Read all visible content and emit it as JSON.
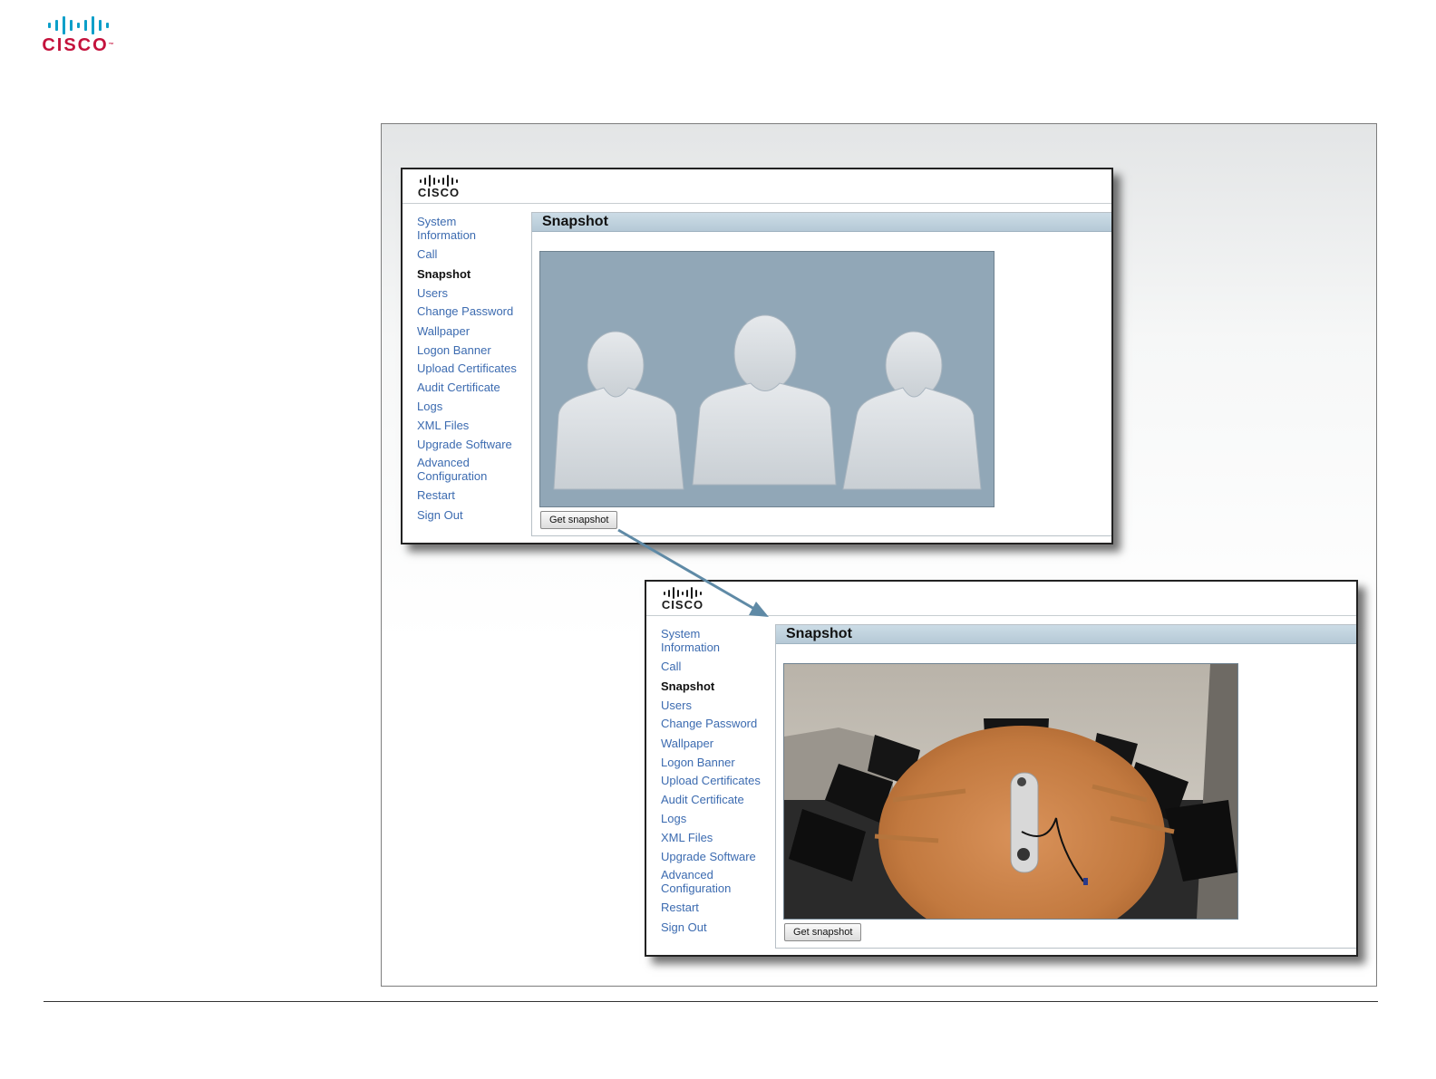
{
  "page": {
    "logo_text": "CISCO",
    "logo_tm": "™"
  },
  "screens": [
    {
      "logo_text": "CISCO",
      "nav": [
        {
          "label": "System Information"
        },
        {
          "label": "Call"
        },
        {
          "label": "Snapshot",
          "active": true
        },
        {
          "label": "Users"
        },
        {
          "label": "Change Password"
        },
        {
          "label": "Wallpaper"
        },
        {
          "label": "Logon Banner"
        },
        {
          "label": "Upload Certificates"
        },
        {
          "label": "Audit Certificate"
        },
        {
          "label": "Logs"
        },
        {
          "label": "XML Files"
        },
        {
          "label": "Upgrade Software"
        },
        {
          "label": "Advanced Configuration"
        },
        {
          "label": "Restart"
        },
        {
          "label": "Sign Out"
        }
      ],
      "title": "Snapshot",
      "button_label": "Get snapshot",
      "snapshot": "placeholder-people"
    },
    {
      "logo_text": "CISCO",
      "nav": [
        {
          "label": "System Information"
        },
        {
          "label": "Call"
        },
        {
          "label": "Snapshot",
          "active": true
        },
        {
          "label": "Users"
        },
        {
          "label": "Change Password"
        },
        {
          "label": "Wallpaper"
        },
        {
          "label": "Logon Banner"
        },
        {
          "label": "Upload Certificates"
        },
        {
          "label": "Audit Certificate"
        },
        {
          "label": "Logs"
        },
        {
          "label": "XML Files"
        },
        {
          "label": "Upgrade Software"
        },
        {
          "label": "Advanced Configuration"
        },
        {
          "label": "Restart"
        },
        {
          "label": "Sign Out"
        }
      ],
      "title": "Snapshot",
      "button_label": "Get snapshot",
      "snapshot": "meeting-room-photo"
    }
  ],
  "colors": {
    "cisco_red": "#c4123c",
    "cisco_blue": "#0b9fc9",
    "nav_link": "#3c6bb0",
    "arrow": "#5f8aa6"
  }
}
